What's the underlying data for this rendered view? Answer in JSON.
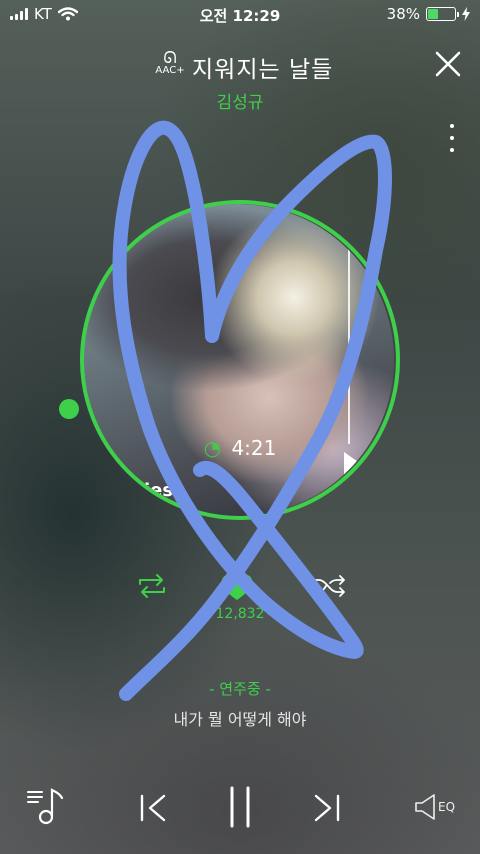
{
  "status_bar": {
    "carrier": "KT",
    "time": "오전 12:29",
    "battery": "38%",
    "battery_level": 0.38
  },
  "header": {
    "codec_label": "AAC+",
    "title": "지워지는 날들",
    "artist": "김성규"
  },
  "player": {
    "total_time": "4:21",
    "album_text": "ies",
    "progress": 0.02
  },
  "actions": {
    "like_count": "12,832"
  },
  "lyrics": {
    "current": "- 연주중 -",
    "next": "내가 뭘 어떻게 해야"
  },
  "bottom": {
    "eq_label": "EQ"
  },
  "colors": {
    "accent": "#3ed04a",
    "scribble": "#6f92e6"
  }
}
